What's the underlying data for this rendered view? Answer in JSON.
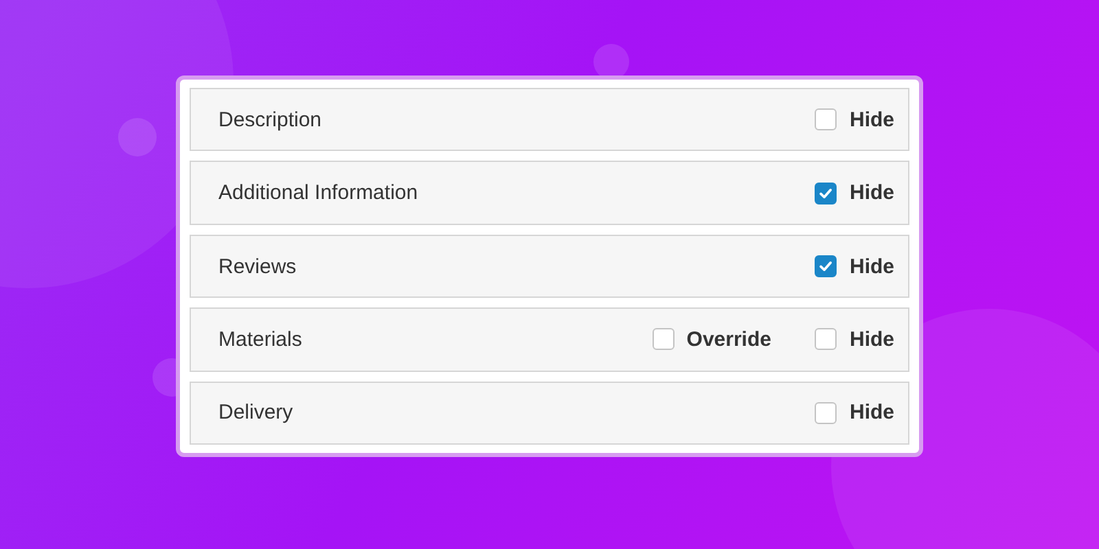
{
  "rows": [
    {
      "label": "Description",
      "options": [
        {
          "label": "Hide",
          "checked": false
        }
      ]
    },
    {
      "label": "Additional Information",
      "options": [
        {
          "label": "Hide",
          "checked": true
        }
      ]
    },
    {
      "label": "Reviews",
      "options": [
        {
          "label": "Hide",
          "checked": true
        }
      ]
    },
    {
      "label": "Materials",
      "options": [
        {
          "label": "Override",
          "checked": false
        },
        {
          "label": "Hide",
          "checked": false
        }
      ]
    },
    {
      "label": "Delivery",
      "options": [
        {
          "label": "Hide",
          "checked": false
        }
      ]
    }
  ]
}
